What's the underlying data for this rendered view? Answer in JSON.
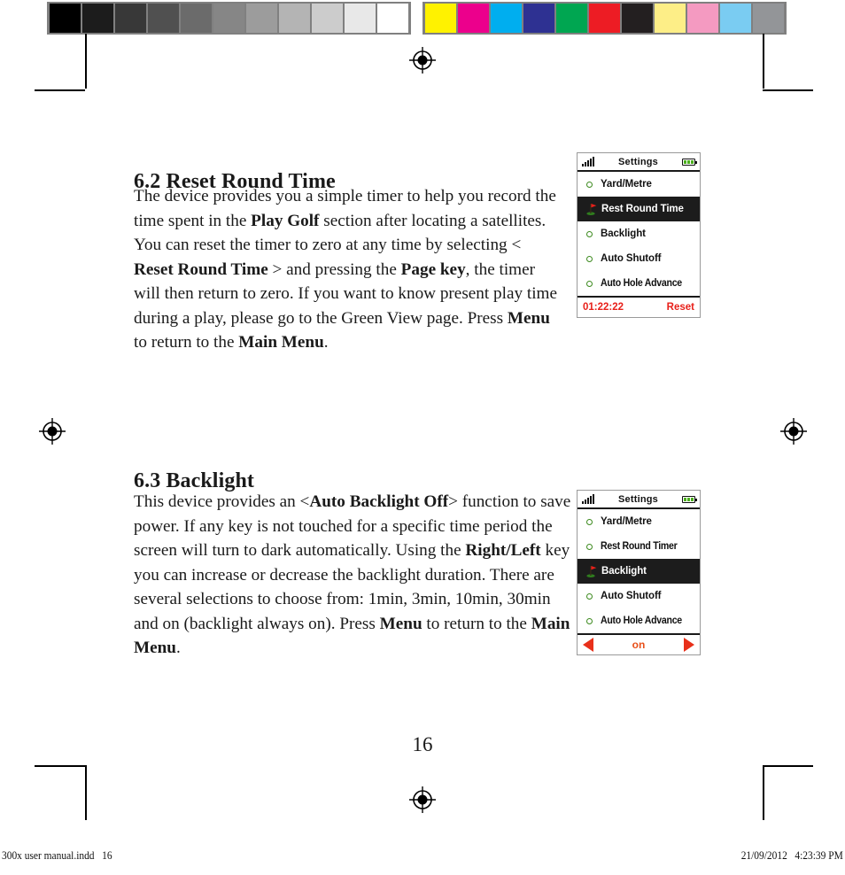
{
  "calibration": {
    "grayscale": [
      "#000000",
      "#1c1c1c",
      "#383838",
      "#505050",
      "#6b6b6b",
      "#868686",
      "#9c9c9c",
      "#b4b4b4",
      "#cccccc",
      "#e8e8e8",
      "#ffffff"
    ],
    "colors": [
      "#fff200",
      "#ec008c",
      "#00aeef",
      "#2e3192",
      "#00a651",
      "#ed1c24",
      "#231f20",
      "#fdee87",
      "#f49ac1",
      "#7accf2",
      "#939598"
    ]
  },
  "sections": [
    {
      "heading": "6.2 Reset Round Time",
      "paragraph_html": "The device provides you a simple timer to help you record the time spent in the <b>Play Golf</b> section after locating a satellites. You can reset the timer to zero at any time by selecting &lt; <b>Reset Round Time</b> &gt; and pressing the <b>Page key</b>, the timer will then return to zero. If you want to know present play time during a play, please go to the Green View page. Press <b>Menu</b> to return to the <b>Main Menu</b>."
    },
    {
      "heading": "6.3 Backlight",
      "paragraph_html": "This device provides an &lt;<b>Auto Backlight Off</b>&gt; function to save power. If any key is not touched for a specific time period the screen will turn to dark automatically. Using the <b>Right/Left</b> key you can increase or decrease the backlight duration. There are several selections to choose from: 1min, 3min, 10min, 30min and on (backlight always on). Press <b>Menu</b> to return to the <b>Main Menu</b>."
    }
  ],
  "device_screens": [
    {
      "id": "settings-rest-round-time",
      "header": {
        "title": "Settings",
        "signal_icon": "signal-bars-icon",
        "battery_icon": "battery-full-icon"
      },
      "items": [
        {
          "label": "Yard/Metre",
          "icon": "circle-bullet-icon",
          "selected": false
        },
        {
          "label": "Rest Round Time",
          "icon": "golf-flag-icon",
          "selected": true
        },
        {
          "label": "Backlight",
          "icon": "circle-bullet-icon",
          "selected": false
        },
        {
          "label": "Auto Shutoff",
          "icon": "circle-bullet-icon",
          "selected": false
        },
        {
          "label": "Auto Hole Advance",
          "icon": "circle-bullet-icon",
          "selected": false
        }
      ],
      "footer": {
        "type": "timer",
        "left_label": "01:22:22",
        "right_label": "Reset",
        "color": "#e8201a"
      }
    },
    {
      "id": "settings-backlight",
      "header": {
        "title": "Settings",
        "signal_icon": "signal-bars-icon",
        "battery_icon": "battery-full-icon"
      },
      "items": [
        {
          "label": "Yard/Metre",
          "icon": "circle-bullet-icon",
          "selected": false
        },
        {
          "label": "Rest Round Timer",
          "icon": "circle-bullet-icon",
          "selected": false
        },
        {
          "label": "Backlight",
          "icon": "golf-flag-icon",
          "selected": true
        },
        {
          "label": "Auto Shutoff",
          "icon": "circle-bullet-icon",
          "selected": false
        },
        {
          "label": "Auto Hole Advance",
          "icon": "circle-bullet-icon",
          "selected": false
        }
      ],
      "footer": {
        "type": "stepper",
        "left_icon": "arrow-left-icon",
        "center_label": "on",
        "right_icon": "arrow-right-icon",
        "color": "#e8301a"
      }
    }
  ],
  "page_number": "16",
  "footer": {
    "left": "300x user manual.indd   16",
    "right": "21/09/2012   4:23:39 PM"
  }
}
